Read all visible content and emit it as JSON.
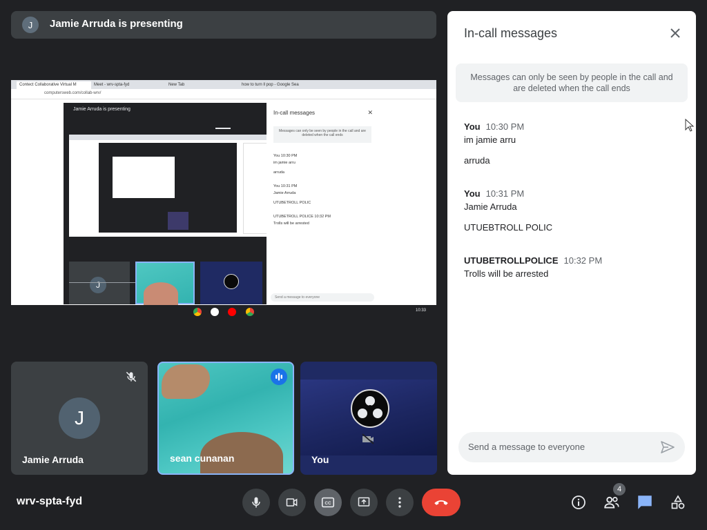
{
  "banner": {
    "avatar_letter": "J",
    "text": "Jamie Arruda is presenting"
  },
  "shared_screen": {
    "tabs": [
      "Contect Collaborative Virtual M",
      "Meet - wrv-spta-fyd",
      "New Tab",
      "how to turn ll pop - Google Sea"
    ],
    "address": "computersweb.com/collab-wrv/",
    "inner_banner": "Jamie Arruda is presenting",
    "mini_chat_title": "In-call messages",
    "mini_notice": "Messages can only be seen by people in the call and are deleted when the call ends",
    "mini_messages": [
      "You  10:30 PM",
      "im jamie arru",
      "arruda",
      "You  10:31 PM",
      "Jamie Arruda",
      "UTUBETROLL POLIC",
      "UTUBETROLL POLICE  10:32 PM",
      "Trolls will be arrested"
    ],
    "mini_input": "Send a message to everyone",
    "mini_avatar": "J",
    "clock": "10:33"
  },
  "tiles": [
    {
      "name": "Jamie Arruda",
      "avatar": "J"
    },
    {
      "name": "sean cunanan"
    },
    {
      "name": "You"
    }
  ],
  "panel": {
    "title": "In-call messages",
    "notice": "Messages can only be seen by people in the call and are deleted when the call ends",
    "messages": [
      {
        "sender": "You",
        "time": "10:30 PM",
        "lines": [
          "im jamie arru",
          "arruda"
        ]
      },
      {
        "sender": "You",
        "time": "10:31 PM",
        "lines": [
          "Jamie Arruda",
          "UTUEBTROLL POLIC"
        ]
      },
      {
        "sender": "UTUBETROLLPOLICE",
        "time": "10:32 PM",
        "lines": [
          "Trolls will be arrested"
        ]
      }
    ],
    "compose_placeholder": "Send a message to everyone"
  },
  "meeting_code": "wrv-spta-fyd",
  "people_count": "4",
  "colors": {
    "end_call": "#ea4335",
    "accent": "#1a73e8",
    "chat_active": "#8ab4f8"
  }
}
